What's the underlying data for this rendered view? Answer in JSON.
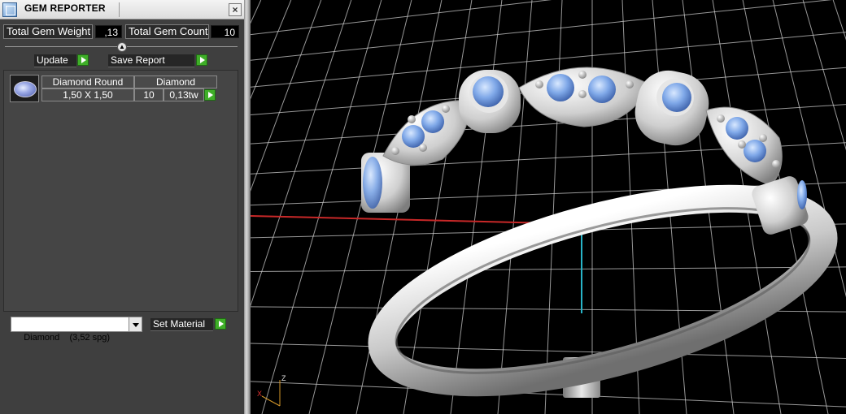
{
  "window": {
    "title": "GEM REPORTER",
    "close_symbol": "×"
  },
  "stats": {
    "total_gem_weight_label": "Total Gem Weight",
    "total_gem_weight_value": ",13",
    "total_gem_count_label": "Total Gem Count",
    "total_gem_count_value": "10"
  },
  "toolbar": {
    "update_label": "Update",
    "save_report_label": "Save Report"
  },
  "gem_list": {
    "rows": [
      {
        "shape": "Diamond Round",
        "material": "Diamond",
        "size": "1,50 X 1,50",
        "count": "10",
        "weight": "0,13tw"
      }
    ]
  },
  "material": {
    "selected": "Diamond    (3,52 spg)",
    "set_label": "Set Material"
  },
  "viewport": {
    "axis_z": "Z",
    "axis_x": "X",
    "colors": {
      "grid": "#d8d8d8",
      "x_axis": "#c82828",
      "y_axis": "#28b4c8",
      "gem": "#7fa8e8",
      "metal": "#c8c8c8"
    }
  }
}
